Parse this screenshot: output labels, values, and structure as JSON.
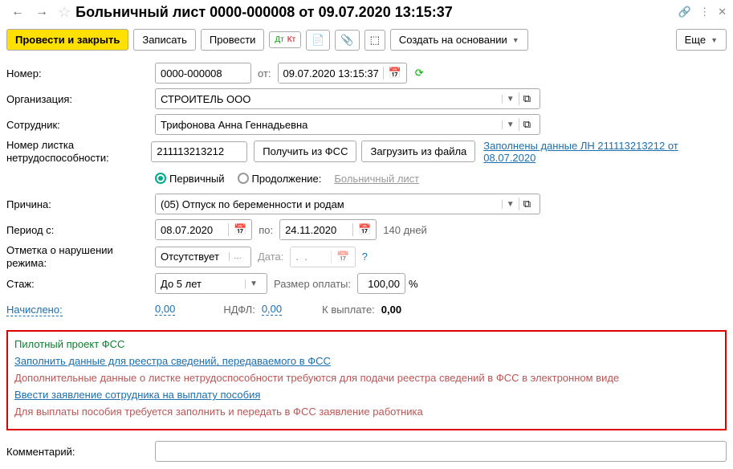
{
  "title": "Больничный лист 0000-000008 от 09.07.2020 13:15:37",
  "toolbar": {
    "post_close": "Провести и закрыть",
    "write": "Записать",
    "post": "Провести",
    "create_based": "Создать на основании",
    "more": "Еще"
  },
  "fields": {
    "number_label": "Номер:",
    "number": "0000-000008",
    "from_label": "от:",
    "date": "09.07.2020 13:15:37",
    "org_label": "Организация:",
    "org": "СТРОИТЕЛЬ ООО",
    "emp_label": "Сотрудник:",
    "emp": "Трифонова Анна Геннадьевна",
    "sheet_no_label": "Номер листка нетрудоспособности:",
    "sheet_no": "211113213212",
    "get_fss": "Получить из ФСС",
    "load_file": "Загрузить из файла",
    "filled_link": "Заполнены данные ЛН 211113213212 от 08.07.2020",
    "primary": "Первичный",
    "continuation": "Продолжение:",
    "sick_sheet_link": "Больничный лист",
    "reason_label": "Причина:",
    "reason": "(05) Отпуск по беременности и родам",
    "period_label": "Период с:",
    "period_from": "08.07.2020",
    "period_to_label": "по:",
    "period_to": "24.11.2020",
    "days": "140 дней",
    "violation_label": "Отметка о нарушении режима:",
    "violation": "Отсутствует",
    "violation_date_label": "Дата:",
    "violation_date": ".  .",
    "stazh_label": "Стаж:",
    "stazh": "До 5 лет",
    "pay_size_label": "Размер оплаты:",
    "pay_size": "100,00",
    "percent": "%",
    "accrued_label": "Начислено:",
    "accrued": "0,00",
    "ndfl_label": "НДФЛ:",
    "ndfl": "0,00",
    "payout_label": "К выплате:",
    "payout": "0,00",
    "comment_label": "Комментарий:"
  },
  "pilot": {
    "title": "Пилотный проект ФСС",
    "link1": "Заполнить данные для реестра сведений, передаваемого в ФСС",
    "note1": "Дополнительные данные о листке нетрудоспособности требуются для подачи реестра сведений в ФСС в электронном виде",
    "link2": "Ввести заявление сотрудника на выплату пособия",
    "note2": "Для выплаты пособия требуется заполнить и передать в ФСС заявление работника"
  }
}
